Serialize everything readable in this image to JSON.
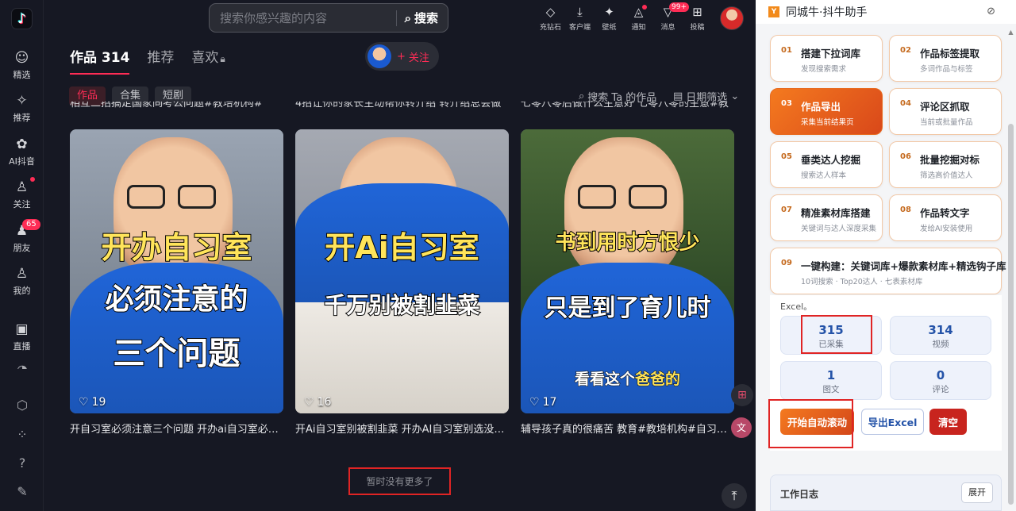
{
  "sidebar": {
    "items": [
      {
        "label": "精选",
        "icon": "feed-icon"
      },
      {
        "label": "推荐",
        "icon": "sparkle-icon"
      },
      {
        "label": "AI抖音",
        "icon": "flower-icon"
      },
      {
        "label": "关注",
        "icon": "follow-icon"
      },
      {
        "label": "朋友",
        "icon": "friends-icon",
        "badge": "65"
      },
      {
        "label": "我的",
        "icon": "user-icon"
      },
      {
        "label": "直播",
        "icon": "live-tv-icon"
      }
    ]
  },
  "search": {
    "placeholder": "搜索你感兴趣的内容",
    "button": "搜索"
  },
  "top_icons": [
    {
      "label": "充钻石",
      "icon": "diamond-icon"
    },
    {
      "label": "客户端",
      "icon": "download-icon"
    },
    {
      "label": "壁纸",
      "icon": "wallpaper-icon"
    },
    {
      "label": "通知",
      "icon": "bell-icon"
    },
    {
      "label": "消息",
      "icon": "message-icon",
      "badge": "99+"
    },
    {
      "label": "投稿",
      "icon": "upload-icon"
    }
  ],
  "profile": {
    "tabs": [
      {
        "label": "作品 314"
      },
      {
        "label": "推荐"
      },
      {
        "label": "喜欢"
      }
    ],
    "follow_label": "关注",
    "filter_chips": [
      {
        "label": "作品"
      },
      {
        "label": "合集"
      },
      {
        "label": "短剧"
      }
    ],
    "search_works": "搜索 Ta 的作品",
    "date_filter": "日期筛选",
    "clipped_titles": [
      "相互二招搞定国家同考公问题#教培机构#",
      "4招让你的家长主动帮你转介绍 转介绍总会做",
      "七零八零后做什么生意好 七零八零的生意#教"
    ]
  },
  "videos": [
    {
      "lines": [
        "开办自习室",
        "必须注意的",
        "三个问题"
      ],
      "likes": "19",
      "title": "开自习室必须注意三个问题 开办ai自习室必须..."
    },
    {
      "lines": [
        "开Ai自习室",
        "千万别被割韭菜"
      ],
      "likes": "16",
      "title": "开Ai自习室别被割韭菜 开办AI自习室别选没支..."
    },
    {
      "lines": [
        "书到用时方恨少",
        "只是到了育儿时",
        "看看这个",
        "爸爸的"
      ],
      "likes": "17",
      "title": "辅导孩子真的很痛苦 教育#教培机构#自习室#..."
    }
  ],
  "no_more": "暂时没有更多了",
  "panel": {
    "title": "同城牛·抖牛助手",
    "steps": [
      {
        "num": "01",
        "title": "搭建下拉词库",
        "sub": "发现搜索需求"
      },
      {
        "num": "02",
        "title": "作品标签提取",
        "sub": "多词作品与标签"
      },
      {
        "num": "03",
        "title": "作品导出",
        "sub": "采集当前结果页"
      },
      {
        "num": "04",
        "title": "评论区抓取",
        "sub": "当前或批量作品"
      },
      {
        "num": "05",
        "title": "垂类达人挖掘",
        "sub": "搜索达人样本"
      },
      {
        "num": "06",
        "title": "批量挖掘对标",
        "sub": "筛选高价值达人"
      },
      {
        "num": "07",
        "title": "精准素材库搭建",
        "sub": "关键词与达人深度采集"
      },
      {
        "num": "08",
        "title": "作品转文字",
        "sub": "发给AI安装使用"
      },
      {
        "num": "09",
        "title": "一键构建：关键词库+爆款素材库+精选钩子库",
        "sub": "10词搜索 · Top20达人 · 七表素材库"
      }
    ],
    "excel_note": "Excel。",
    "stats": [
      {
        "value": "315",
        "label": "已采集"
      },
      {
        "value": "314",
        "label": "视频"
      },
      {
        "value": "1",
        "label": "图文"
      },
      {
        "value": "0",
        "label": "评论"
      }
    ],
    "buttons": {
      "auto_scroll": "开始自动滚动",
      "export_excel": "导出Excel",
      "clear": "清空"
    },
    "log": {
      "title": "工作日志",
      "expand": "展开"
    }
  }
}
